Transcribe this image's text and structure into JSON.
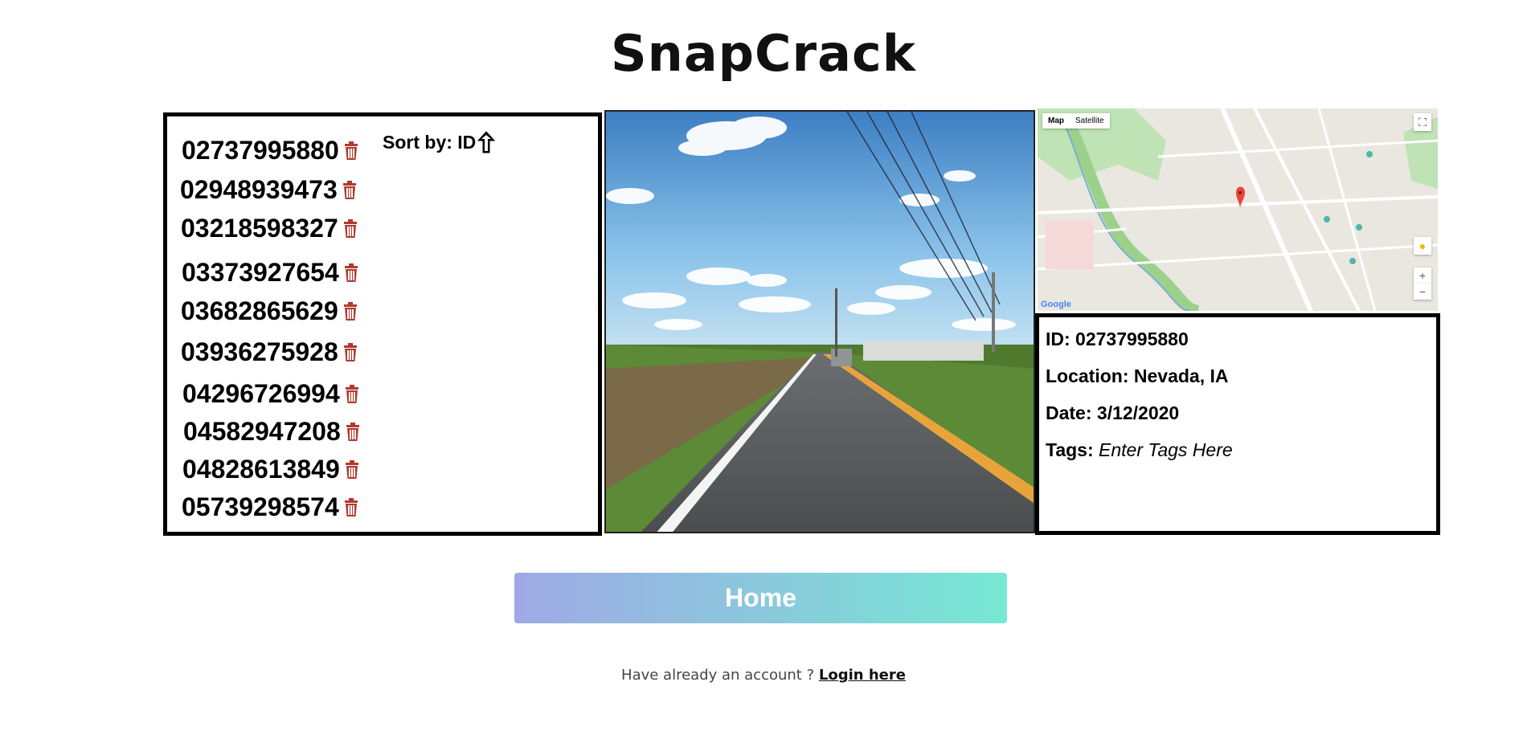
{
  "app": {
    "title": "SnapCrack"
  },
  "list": {
    "sort_label": "Sort by: ID",
    "ids": [
      "02737995880",
      "02948939473",
      "03218598327",
      "03373927654",
      "03682865629",
      "03936275928",
      "04296726994",
      "04582947208",
      "04828613849",
      "05739298574"
    ]
  },
  "map": {
    "tab_map": "Map",
    "tab_satellite": "Satellite",
    "zoom_in": "+",
    "zoom_out": "−",
    "fullscreen": "⛶",
    "attribution": "Google"
  },
  "details": {
    "id": "ID: 02737995880",
    "location": "Location: Nevada, IA",
    "date": "Date: 3/12/2020",
    "tags_label": "Tags:",
    "tags_placeholder": "Enter Tags Here"
  },
  "home_button": "Home",
  "footer": {
    "text": "Have already an account ?",
    "link": "Login here"
  },
  "colors": {
    "trash": "#b03a2e",
    "gradient_start": "#9fa9e5",
    "gradient_end": "#76e8d3"
  }
}
